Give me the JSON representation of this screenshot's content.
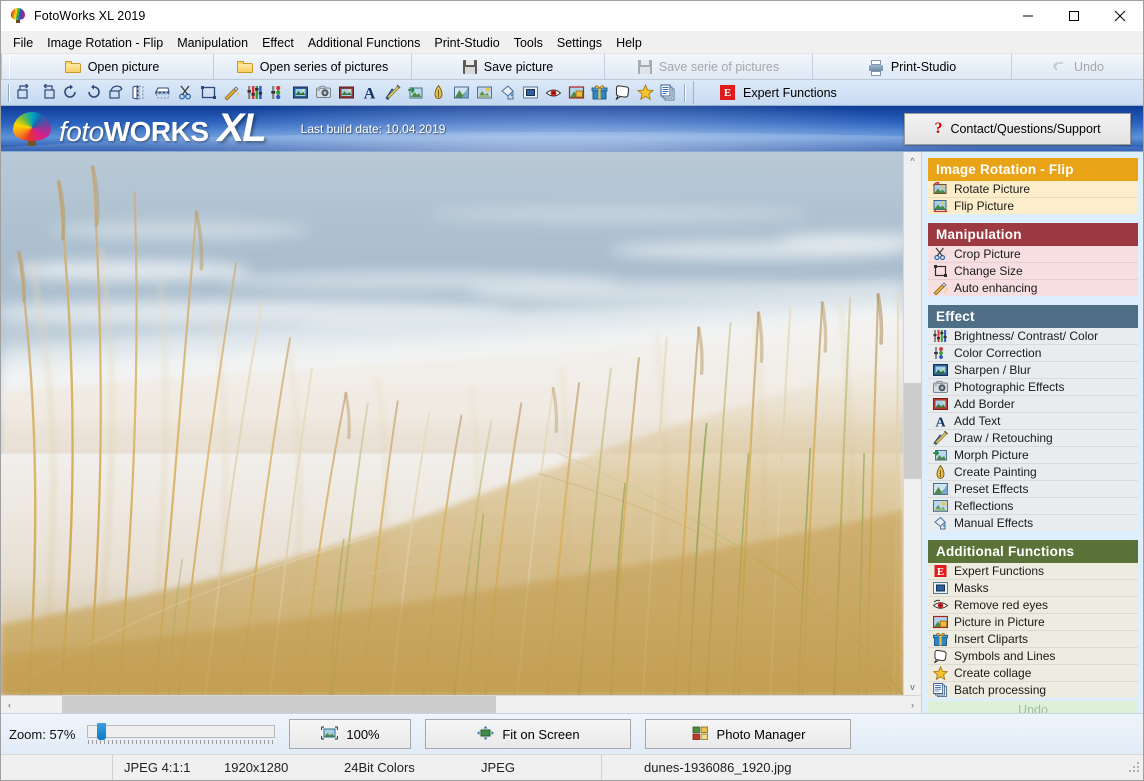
{
  "window": {
    "title": "FotoWorks XL 2019",
    "app_icon": "hot-air-balloon-icon",
    "controls": {
      "minimize": "minimize-icon",
      "maximize": "maximize-icon",
      "close": "close-icon"
    }
  },
  "menubar": {
    "items": [
      {
        "label": "File",
        "accel": "F"
      },
      {
        "label": "Image Rotation - Flip",
        "accel": "g"
      },
      {
        "label": "Manipulation",
        "accel": "M"
      },
      {
        "label": "Effect",
        "accel": "E"
      },
      {
        "label": "Additional Functions",
        "accel": "d"
      },
      {
        "label": "Print-Studio",
        "accel": "P"
      },
      {
        "label": "Tools",
        "accel": "T"
      },
      {
        "label": "Settings",
        "accel": "S"
      },
      {
        "label": "Help",
        "accel": "H"
      }
    ]
  },
  "toolbar_main": {
    "buttons": [
      {
        "label": "Open picture",
        "icon": "folder-icon",
        "disabled": false
      },
      {
        "label": "Open series of pictures",
        "icon": "folder-icon",
        "disabled": false
      },
      {
        "label": "Save picture",
        "icon": "floppy-disk-icon",
        "disabled": false
      },
      {
        "label": "Save serie of pictures",
        "icon": "floppy-disk-icon",
        "disabled": true
      },
      {
        "label": "Print-Studio",
        "icon": "printer-icon",
        "disabled": false
      },
      {
        "label": "Undo",
        "icon": "undo-arrow-icon",
        "disabled": true
      }
    ]
  },
  "toolbar_icons": {
    "expert_label": "Expert Functions",
    "expert_icon": "expert-e-icon",
    "items": [
      "rotate-left-icon",
      "rotate-right-icon",
      "rotate-cw-icon",
      "rotate-ccw-icon",
      "rotate-free-icon",
      "flip-vertical-icon",
      "flip-horizontal-icon",
      "crop-scissors-icon",
      "change-size-icon",
      "auto-enhance-wand-icon",
      "brightness-contrast-icon",
      "color-correction-icon",
      "sharpen-blur-icon",
      "photographic-effects-icon",
      "add-border-icon",
      "add-text-icon",
      "draw-retouching-icon",
      "morph-picture-icon",
      "create-painting-pen-icon",
      "preset-effects-icon",
      "reflections-icon",
      "manual-effects-bucket-icon",
      "masks-icon",
      "remove-red-eyes-icon",
      "picture-in-picture-icon",
      "insert-cliparts-icon",
      "symbols-and-lines-icon",
      "create-collage-star-icon",
      "batch-processing-icon"
    ]
  },
  "banner": {
    "logo_text_1": "foto",
    "logo_text_2": "WORKS",
    "logo_text_3": "XL",
    "build_date": "Last build date: 10.04.2019",
    "contact_label": "Contact/Questions/Support",
    "contact_icon": "question-mark-icon",
    "balloon_icon": "hot-air-balloon-icon"
  },
  "sidebar": {
    "sections": [
      {
        "title": "Image Rotation - Flip",
        "header_color": "#e8a317",
        "item_bg": "#fdeecb",
        "items": [
          {
            "label": "Rotate Picture",
            "icon": "rotate-picture-icon"
          },
          {
            "label": "Flip Picture",
            "icon": "flip-picture-icon"
          }
        ]
      },
      {
        "title": "Manipulation",
        "header_color": "#9d3a41",
        "item_bg": "#f7dfe1",
        "items": [
          {
            "label": "Crop Picture",
            "icon": "crop-scissors-icon"
          },
          {
            "label": "Change Size",
            "icon": "change-size-icon"
          },
          {
            "label": "Auto enhancing",
            "icon": "auto-enhance-wand-icon"
          }
        ]
      },
      {
        "title": "Effect",
        "header_color": "#4f6f87",
        "item_bg": "#e9ecee",
        "items": [
          {
            "label": "Brightness/ Contrast/ Color",
            "icon": "brightness-contrast-icon"
          },
          {
            "label": "Color Correction",
            "icon": "color-correction-icon"
          },
          {
            "label": "Sharpen / Blur",
            "icon": "sharpen-blur-icon"
          },
          {
            "label": "Photographic Effects",
            "icon": "photographic-effects-icon"
          },
          {
            "label": "Add Border",
            "icon": "add-border-icon"
          },
          {
            "label": "Add Text",
            "icon": "add-text-icon"
          },
          {
            "label": "Draw / Retouching",
            "icon": "draw-retouching-icon"
          },
          {
            "label": "Morph Picture",
            "icon": "morph-picture-icon"
          },
          {
            "label": "Create Painting",
            "icon": "create-painting-pen-icon"
          },
          {
            "label": "Preset Effects",
            "icon": "preset-effects-icon"
          },
          {
            "label": "Reflections",
            "icon": "reflections-icon"
          },
          {
            "label": "Manual Effects",
            "icon": "manual-effects-bucket-icon"
          }
        ]
      },
      {
        "title": "Additional Functions",
        "header_color": "#5b7338",
        "item_bg": "#eeece0",
        "items": [
          {
            "label": "Expert Functions",
            "icon": "expert-e-icon"
          },
          {
            "label": "Masks",
            "icon": "masks-icon"
          },
          {
            "label": "Remove red eyes",
            "icon": "remove-red-eyes-icon"
          },
          {
            "label": "Picture in Picture",
            "icon": "picture-in-picture-icon"
          },
          {
            "label": "Insert Cliparts",
            "icon": "insert-cliparts-icon"
          },
          {
            "label": "Symbols and Lines",
            "icon": "symbols-and-lines-icon"
          },
          {
            "label": "Create collage",
            "icon": "create-collage-star-icon"
          },
          {
            "label": "Batch processing",
            "icon": "batch-processing-icon"
          }
        ]
      }
    ],
    "undo_label": "Undo"
  },
  "bottombar": {
    "zoom_label": "Zoom: 57%",
    "zoom_percent": 57,
    "slider_position_percent": 6,
    "buttons": [
      {
        "label": "100%",
        "icon": "zoom-100-icon"
      },
      {
        "label": "Fit on Screen",
        "icon": "fit-on-screen-icon"
      },
      {
        "label": "Photo Manager",
        "icon": "photo-manager-icon"
      }
    ]
  },
  "statusbar": {
    "format": "JPEG  4:1:1",
    "dimensions": "1920x1280",
    "colors": "24Bit Colors",
    "type": "JPEG",
    "filename": "dunes-1936086_1920.jpg"
  },
  "photo": {
    "alt": "beach dune grass in front of sea",
    "colors": {
      "sky": "#b4c6d4",
      "sea": "#9db4c6",
      "foam": "#eef3f6",
      "sand": "#e7ddd2",
      "grass_gold": "#d8a849",
      "grass_green": "#9aa84e",
      "grass_pale": "#e3cd9a"
    }
  }
}
